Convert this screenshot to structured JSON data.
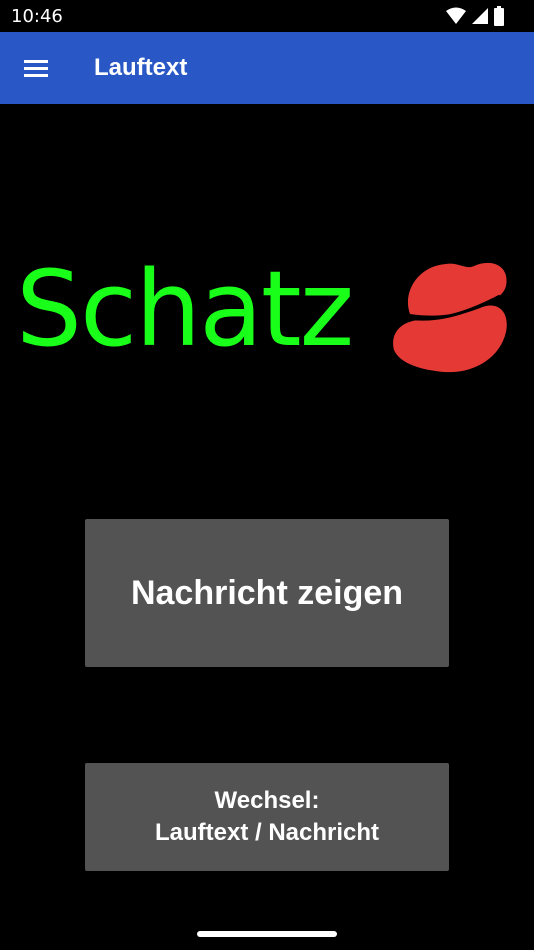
{
  "status_bar": {
    "time": "10:46"
  },
  "app_bar": {
    "title": "Lauftext",
    "menu_icon": "hamburger-menu-icon"
  },
  "marquee": {
    "text": "Schatz",
    "text_color": "#19ff19",
    "emoji_icon": "kiss-lips-icon",
    "emoji_color": "#e53935"
  },
  "buttons": {
    "show_message": "Nachricht zeigen",
    "switch_line1": "Wechsel:",
    "switch_line2": "Lauftext / Nachricht"
  },
  "colors": {
    "app_bar": "#2957c5",
    "button": "#535353",
    "background": "#000000"
  }
}
